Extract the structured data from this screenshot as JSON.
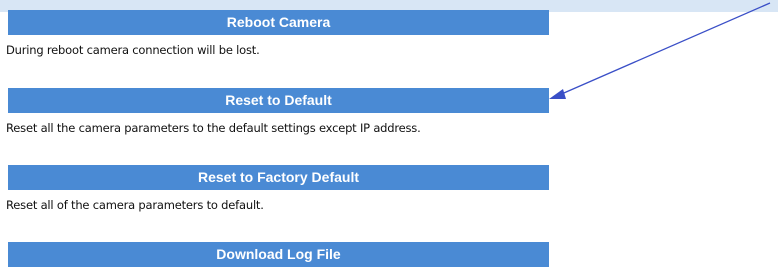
{
  "actions": [
    {
      "label": "Reboot Camera",
      "description": "During reboot camera connection will be lost."
    },
    {
      "label": "Reset to Default",
      "description": "Reset all the camera parameters to the default settings except IP address."
    },
    {
      "label": "Reset to Factory Default",
      "description": "Reset all of the camera parameters to default."
    },
    {
      "label": "Download Log File",
      "description": ""
    }
  ],
  "colors": {
    "button": "#4a8ad4",
    "button_text": "#ffffff",
    "top_band": "#d8e6f5",
    "annotation_arrow": "#3a4fc7"
  },
  "annotation": {
    "icon": "pointer-arrow-icon",
    "points_to": "Reset to Default"
  }
}
